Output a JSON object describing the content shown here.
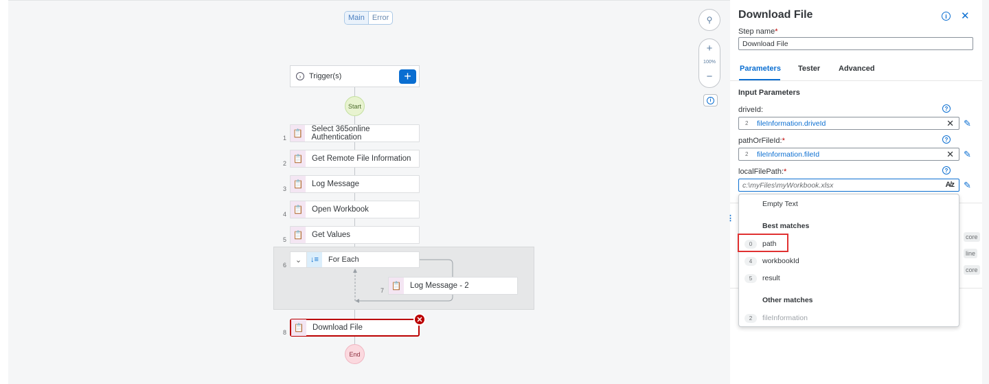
{
  "canvas": {
    "toggle": {
      "main": "Main",
      "error": "Error"
    },
    "trigger": {
      "label": "Trigger(s)",
      "add": "+"
    },
    "start_label": "Start",
    "end_label": "End",
    "steps": [
      {
        "num": "1",
        "label": "Select 365online Authentication"
      },
      {
        "num": "2",
        "label": "Get Remote File Information"
      },
      {
        "num": "3",
        "label": "Log Message"
      },
      {
        "num": "4",
        "label": "Open Workbook"
      },
      {
        "num": "5",
        "label": "Get Values"
      },
      {
        "num": "6",
        "label": "For Each"
      },
      {
        "num": "7",
        "label": "Log Message - 2"
      },
      {
        "num": "8",
        "label": "Download File"
      }
    ],
    "zoom": {
      "level": "100%",
      "plus": "+",
      "minus": "−"
    }
  },
  "panel": {
    "title": "Download File",
    "step_name_label": "Step name",
    "step_name_value": "Download File",
    "tabs": [
      "Parameters",
      "Tester",
      "Advanced"
    ],
    "section": "Input Parameters",
    "params": [
      {
        "label": "driveId:",
        "required": false,
        "count": "2",
        "value": "fileInformation.driveId"
      },
      {
        "label": "pathOrFileId:",
        "required": true,
        "count": "2",
        "value": "fileInformation.fileId"
      },
      {
        "label": "localFilePath:",
        "required": true,
        "value": "c:\\myFiles\\myWorkbook.xlsx"
      }
    ],
    "peek": [
      "core",
      "line",
      "core"
    ]
  },
  "dropdown": {
    "empty": "Empty Text",
    "best_header": "Best matches",
    "best": [
      {
        "count": "0",
        "label": "path"
      },
      {
        "count": "4",
        "label": "workbookId"
      },
      {
        "count": "5",
        "label": "result"
      }
    ],
    "other_header": "Other matches",
    "other": [
      {
        "count": "2",
        "label": "fileInformation"
      }
    ]
  },
  "colors": {
    "accent": "#0a6ed1",
    "error": "#bb0000",
    "highlight": "#e03030"
  }
}
